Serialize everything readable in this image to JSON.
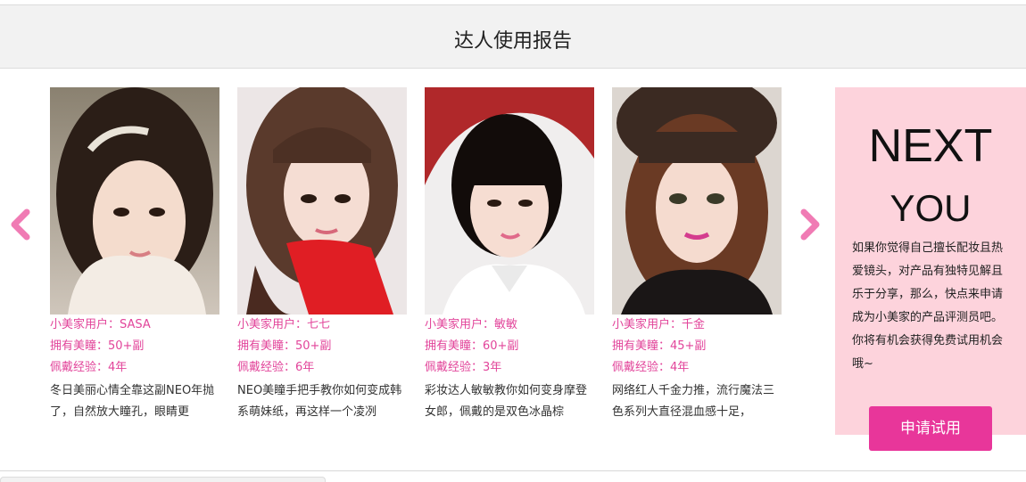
{
  "header": {
    "title": "达人使用报告"
  },
  "carousel": {
    "prev_icon": "chevron-left-icon",
    "next_icon": "chevron-right-icon",
    "arrow_color": "#f07bb4",
    "cards": [
      {
        "user": "小美家用户：SASA",
        "pairs": "拥有美瞳：50+副",
        "experience": "佩戴经验：4年",
        "description": "冬日美丽心情全靠这副NEO年抛了，自然放大瞳孔，眼睛更"
      },
      {
        "user": "小美家用户：七七",
        "pairs": "拥有美瞳：50+副",
        "experience": "佩戴经验：6年",
        "description": "NEO美瞳手把手教你如何变成韩系萌妹纸，再这样一个凌冽"
      },
      {
        "user": "小美家用户：敏敏",
        "pairs": "拥有美瞳：60+副",
        "experience": "佩戴经验：3年",
        "description": "彩妆达人敏敏教你如何变身摩登女郎，佩戴的是双色冰晶棕"
      },
      {
        "user": "小美家用户：千金",
        "pairs": "拥有美瞳：45+副",
        "experience": "佩戴经验：4年",
        "description": "网络红人千金力推，流行魔法三色系列大直径混血感十足，"
      }
    ]
  },
  "next_panel": {
    "title_line1": "NEXT",
    "title_line2": "YOU",
    "text": "如果你觉得自己擅长配妆且热爱镜头，对产品有独特见解且乐于分享，那么，快点来申请成为小美家的产品评测员吧。",
    "text2": "你将有机会获得免费试用机会哦~",
    "apply_label": "申请试用",
    "background": "#fdd3dc",
    "button_color": "#e8369a"
  }
}
